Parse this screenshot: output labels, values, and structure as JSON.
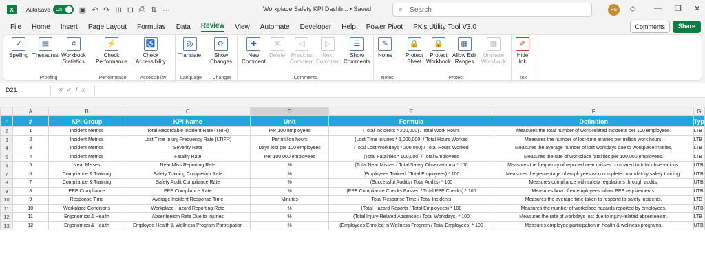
{
  "titlebar": {
    "app_logo": "X",
    "autosave_label": "AutoSave",
    "autosave_state": "On",
    "doc_title": "Workplace Safety KPI Dashb...",
    "saved_status": "• Saved",
    "search_placeholder": "Search",
    "avatar_initials": "PS"
  },
  "menu": {
    "items": [
      "File",
      "Home",
      "Insert",
      "Page Layout",
      "Formulas",
      "Data",
      "Review",
      "View",
      "Automate",
      "Developer",
      "Help",
      "Power Pivot",
      "PK's Utility Tool V3.0"
    ],
    "active": "Review",
    "comments_label": "Comments",
    "share_label": "Share"
  },
  "ribbon": {
    "proofing": {
      "label": "Proofing",
      "spelling": "Spelling",
      "thesaurus": "Thesaurus",
      "workbook_statistics_1": "Workbook",
      "workbook_statistics_2": "Statistics"
    },
    "performance": {
      "label": "Performance",
      "check_1": "Check",
      "check_2": "Performance"
    },
    "accessibility": {
      "label": "Accessibility",
      "check_1": "Check",
      "check_2": "Accessibility"
    },
    "language": {
      "label": "Language",
      "translate": "Translate"
    },
    "changes": {
      "label": "Changes",
      "show_1": "Show",
      "show_2": "Changes"
    },
    "comments": {
      "label": "Comments",
      "new_1": "New",
      "new_2": "Comment",
      "delete": "Delete",
      "prev_1": "Previous",
      "prev_2": "Comment",
      "next_1": "Next",
      "next_2": "Comment",
      "show_1": "Show",
      "show_2": "Comments"
    },
    "notes": {
      "label": "Notes",
      "notes": "Notes"
    },
    "protect": {
      "label": "Protect",
      "sheet_1": "Protect",
      "sheet_2": "Sheet",
      "wb_1": "Protect",
      "wb_2": "Workbook",
      "edit_1": "Allow Edit",
      "edit_2": "Ranges",
      "unshare_1": "Unshare",
      "unshare_2": "Workbook"
    },
    "ink": {
      "label": "Ink",
      "hide_1": "Hide",
      "hide_2": "Ink"
    }
  },
  "formula_bar": {
    "cell_ref": "D21",
    "formula": ""
  },
  "columns": [
    "A",
    "B",
    "C",
    "D",
    "E",
    "F",
    "G"
  ],
  "header_row": {
    "num": "#",
    "group": "KPI Group",
    "name": "KPI Name",
    "unit": "Unit",
    "formula": "Formula",
    "definition": "Definition",
    "type": "Typ"
  },
  "rows": [
    {
      "r": "2",
      "n": "1",
      "g": "Incident Metrics",
      "k": "Total Recordable Incident Rate (TRIR)",
      "u": "Per 100 employees",
      "f": "(Total Incidents * 200,000) / Total Work Hours",
      "d": "Measures the total number of work-related incidents per 100 employees.",
      "t": "LTB"
    },
    {
      "r": "3",
      "n": "2",
      "g": "Incident Metrics",
      "k": "Lost Time Injury Frequency Rate (LTIFR)",
      "u": "Per million hours",
      "f": "(Lost Time Injuries * 1,000,000) / Total Hours Worked",
      "d": "Measures the number of lost-time injuries per million work hours.",
      "t": "LTB"
    },
    {
      "r": "4",
      "n": "3",
      "g": "Incident Metrics",
      "k": "Severity Rate",
      "u": "Days lost per 100 employees",
      "f": "(Total Lost Workdays * 200,000) / Total Hours Worked",
      "d": "Measures the average number of lost workdays due to workplace injuries.",
      "t": "LTB"
    },
    {
      "r": "5",
      "n": "4",
      "g": "Incident Metrics",
      "k": "Fatality Rate",
      "u": "Per 100,000 employees",
      "f": "(Total Fatalities * 100,000) / Total Employees",
      "d": "Measures the rate of workplace fatalities per 100,000 employees.",
      "t": "LTB"
    },
    {
      "r": "6",
      "n": "5",
      "g": "Near Misses",
      "k": "Near Miss Reporting Rate",
      "u": "%",
      "f": "(Total Near Misses / Total Safety Observations) * 100",
      "d": "Measures the frequency of reported near misses compared to total observations.",
      "t": "UTB"
    },
    {
      "r": "7",
      "n": "6",
      "g": "Compliance & Training",
      "k": "Safety Training Completion Rate",
      "u": "%",
      "f": "(Employees Trained / Total Employees) * 100",
      "d": "Measures the percentage of employees who completed mandatory safety training.",
      "t": "UTB"
    },
    {
      "r": "8",
      "n": "7",
      "g": "Compliance & Training",
      "k": "Safety Audit Compliance Rate",
      "u": "%",
      "f": "(Successful Audits / Total Audits) * 100",
      "d": "Measures compliance with safety regulations through audits.",
      "t": "UTB"
    },
    {
      "r": "9",
      "n": "8",
      "g": "PPE Compliance",
      "k": "PPE Compliance Rate",
      "u": "%",
      "f": "(PPE Compliance Checks Passed / Total PPE Checks) * 100",
      "d": "Measures how often employees follow PPE requirements.",
      "t": "UTB"
    },
    {
      "r": "10",
      "n": "9",
      "g": "Response Time",
      "k": "Average Incident Response Time",
      "u": "Minutes",
      "f": "Total Response Time / Total Incidents",
      "d": "Measures the average time taken to respond to safety incidents.",
      "t": "LTB"
    },
    {
      "r": "11",
      "n": "10",
      "g": "Workplace Conditions",
      "k": "Workplace Hazard Reporting Rate",
      "u": "%",
      "f": "(Total Hazard Reports / Total Employees) * 100",
      "d": "Measures the number of workplace hazards reported by employees.",
      "t": "UTB"
    },
    {
      "r": "12",
      "n": "11",
      "g": "Ergonomics & Health",
      "k": "Absenteeism Rate Due to Injuries",
      "u": "%",
      "f": "(Total Injury-Related Absences / Total Workdays) * 100",
      "d": "Measures the rate of workdays lost due to injury-related absenteeism.",
      "t": "LTB"
    },
    {
      "r": "13",
      "n": "12",
      "g": "Ergonomics & Health",
      "k": "Employee Health & Wellness Program Participation",
      "u": "%",
      "f": "(Employees Enrolled in Wellness Program / Total Employees) * 100",
      "d": "Measures employee participation in health & wellness programs.",
      "t": "UTB"
    }
  ]
}
